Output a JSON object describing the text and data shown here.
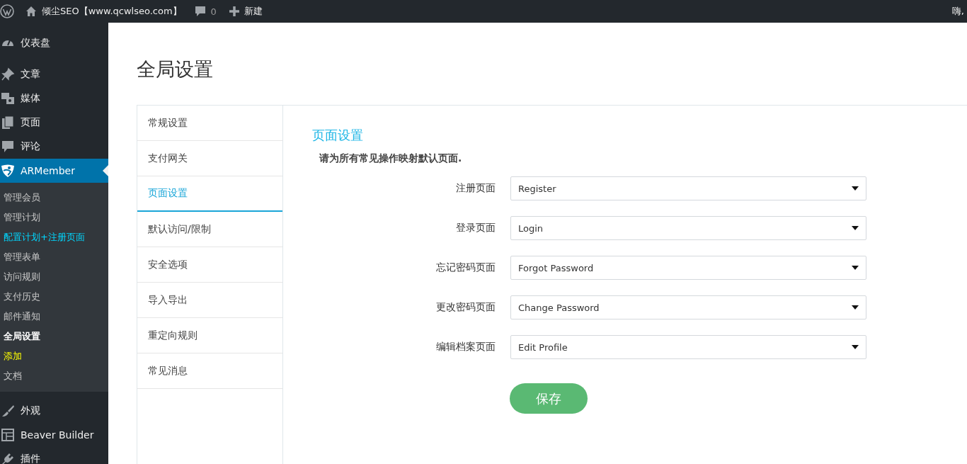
{
  "admin_bar": {
    "site_name": "倾尘SEO【www.qcwlseo.com】",
    "comments_count": "0",
    "new_label": "新建",
    "greeting": "嗨,"
  },
  "sidebar": {
    "items": [
      {
        "label": "仪表盘",
        "selected": false
      },
      {
        "label": "文章",
        "selected": false
      },
      {
        "label": "媒体",
        "selected": false
      },
      {
        "label": "页面",
        "selected": false
      },
      {
        "label": "评论",
        "selected": false
      },
      {
        "label": "ARMember",
        "selected": true,
        "children": [
          {
            "label": "管理会员",
            "kind": "link"
          },
          {
            "label": "管理计划",
            "kind": "link"
          },
          {
            "label": "配置计划+注册页面",
            "kind": "highlight"
          },
          {
            "label": "管理表单",
            "kind": "link"
          },
          {
            "label": "访问规则",
            "kind": "link"
          },
          {
            "label": "支付历史",
            "kind": "link"
          },
          {
            "label": "邮件通知",
            "kind": "link"
          },
          {
            "label": "全局设置",
            "kind": "current"
          },
          {
            "label": "添加",
            "kind": "addon"
          },
          {
            "label": "文档",
            "kind": "link"
          }
        ]
      },
      {
        "label": "外观",
        "selected": false
      },
      {
        "label": "Beaver Builder",
        "selected": false
      },
      {
        "label": "插件",
        "selected": false
      }
    ]
  },
  "page_title": "全局设置",
  "tabs": [
    {
      "label": "常规设置",
      "selected": false
    },
    {
      "label": "支付网关",
      "selected": false
    },
    {
      "label": "页面设置",
      "selected": true
    },
    {
      "label": "默认访问/限制",
      "selected": false
    },
    {
      "label": "安全选项",
      "selected": false
    },
    {
      "label": "导入导出",
      "selected": false
    },
    {
      "label": "重定向规则",
      "selected": false
    },
    {
      "label": "常见消息",
      "selected": false
    }
  ],
  "section": {
    "title": "页面设置",
    "description": "请为所有常见操作映射默认页面.",
    "fields": [
      {
        "label": "注册页面",
        "value": "Register"
      },
      {
        "label": "登录页面",
        "value": "Login"
      },
      {
        "label": "忘记密码页面",
        "value": "Forgot Password"
      },
      {
        "label": "更改密码页面",
        "value": "Change Password"
      },
      {
        "label": "编辑档案页面",
        "value": "Edit Profile"
      }
    ],
    "save_button": "保存"
  }
}
